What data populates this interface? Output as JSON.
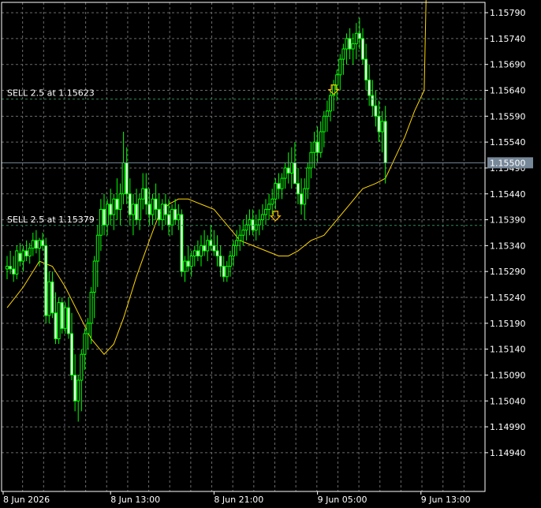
{
  "chart_data": {
    "type": "candlestick",
    "background": "#000000",
    "grid": true,
    "colors": {
      "bull_body": "#000000",
      "bear_body": "#ffffff",
      "bull_wick": "#00ff00",
      "bear_wick": "#00ff00",
      "bull_outline": "#00ff00",
      "bear_outline": "#00ff00",
      "moving_average": "#ffd700",
      "grid": "#6b6b6b",
      "axis_text": "#ffffff",
      "current_price_line": "#778899",
      "trade_level_line": "#2e8b57",
      "sell_arrow": "#ffc000"
    },
    "y_axis": {
      "min": 1.1492,
      "max": 1.158,
      "ticks": [
        "1.15790",
        "1.15740",
        "1.15690",
        "1.15640",
        "1.15590",
        "1.15540",
        "1.15490",
        "1.15440",
        "1.15390",
        "1.15340",
        "1.15290",
        "1.15240",
        "1.15190",
        "1.15140",
        "1.15090",
        "1.15040",
        "1.14990",
        "1.14940"
      ]
    },
    "x_axis": {
      "ticks": [
        {
          "label": "8 Jun 2026",
          "bar": 0
        },
        {
          "label": "8 Jun 13:00",
          "bar": 32
        },
        {
          "label": "8 Jun 21:00",
          "bar": 64
        },
        {
          "label": "9 Jun 05:00",
          "bar": 96
        },
        {
          "label": "9 Jun 13:00",
          "bar": 128
        }
      ]
    },
    "current_price": {
      "value": 1.155,
      "label": "1.15500"
    },
    "trade_levels": [
      {
        "label": "SELL 2.5 at 1.15623",
        "price": 1.15623,
        "arrow_bar": 101
      },
      {
        "label": "SELL 2.5 at 1.15379",
        "price": 1.15379,
        "arrow_bar": 83
      }
    ],
    "moving_average": [
      [
        0,
        1.1522
      ],
      [
        5,
        1.1526
      ],
      [
        10,
        1.1531
      ],
      [
        14,
        1.153
      ],
      [
        18,
        1.1526
      ],
      [
        22,
        1.1521
      ],
      [
        26,
        1.1516
      ],
      [
        30,
        1.1513
      ],
      [
        33,
        1.1515
      ],
      [
        36,
        1.152
      ],
      [
        40,
        1.1528
      ],
      [
        44,
        1.1535
      ],
      [
        47,
        1.154
      ],
      [
        50,
        1.1542
      ],
      [
        53,
        1.1543
      ],
      [
        56,
        1.1543
      ],
      [
        60,
        1.1542
      ],
      [
        64,
        1.1541
      ],
      [
        68,
        1.1538
      ],
      [
        72,
        1.1535
      ],
      [
        76,
        1.1534
      ],
      [
        80,
        1.1533
      ],
      [
        84,
        1.1532
      ],
      [
        87,
        1.1532
      ],
      [
        90,
        1.1533
      ],
      [
        94,
        1.1535
      ],
      [
        98,
        1.1536
      ],
      [
        102,
        1.1539
      ],
      [
        106,
        1.1542
      ],
      [
        110,
        1.1545
      ],
      [
        114,
        1.1546
      ],
      [
        117,
        1.1547
      ],
      [
        120,
        1.1551
      ],
      [
        123,
        1.1555
      ],
      [
        126,
        1.156
      ],
      [
        129,
        1.1564
      ],
      [
        132,
        1.1666
      ],
      [
        135,
        1.1668
      ],
      [
        138,
        1.1668
      ],
      [
        141,
        1.1669
      ],
      [
        144,
        1.1668
      ],
      [
        147,
        1.1665
      ]
    ],
    "candles": [
      [
        1.15295,
        1.1532,
        1.15275,
        1.153
      ],
      [
        1.153,
        1.1533,
        1.15285,
        1.15295
      ],
      [
        1.15295,
        1.1532,
        1.1527,
        1.15285
      ],
      [
        1.15285,
        1.1534,
        1.15275,
        1.1533
      ],
      [
        1.15325,
        1.15345,
        1.153,
        1.1531
      ],
      [
        1.1531,
        1.1534,
        1.1529,
        1.1533
      ],
      [
        1.1533,
        1.1535,
        1.1531,
        1.1532
      ],
      [
        1.1532,
        1.15345,
        1.15305,
        1.15335
      ],
      [
        1.15335,
        1.15365,
        1.1532,
        1.1535
      ],
      [
        1.1535,
        1.1537,
        1.15325,
        1.15335
      ],
      [
        1.15335,
        1.15355,
        1.153,
        1.1535
      ],
      [
        1.1535,
        1.15365,
        1.1533,
        1.1534
      ],
      [
        1.1534,
        1.15355,
        1.1519,
        1.15205
      ],
      [
        1.15205,
        1.1529,
        1.1519,
        1.1527
      ],
      [
        1.1527,
        1.1529,
        1.152,
        1.1521
      ],
      [
        1.1521,
        1.1525,
        1.1515,
        1.1516
      ],
      [
        1.1516,
        1.1524,
        1.1515,
        1.1523
      ],
      [
        1.1523,
        1.1524,
        1.1517,
        1.1518
      ],
      [
        1.1518,
        1.1523,
        1.1517,
        1.1522
      ],
      [
        1.1522,
        1.1524,
        1.1516,
        1.1517
      ],
      [
        1.1517,
        1.1521,
        1.1508,
        1.1509
      ],
      [
        1.1509,
        1.1513,
        1.1502,
        1.1504
      ],
      [
        1.1504,
        1.1509,
        1.15,
        1.1508
      ],
      [
        1.1508,
        1.1514,
        1.1502,
        1.1513
      ],
      [
        1.1513,
        1.1518,
        1.151,
        1.1517
      ],
      [
        1.1517,
        1.152,
        1.1514,
        1.1519
      ],
      [
        1.1519,
        1.1526,
        1.1515,
        1.1525
      ],
      [
        1.1525,
        1.1532,
        1.152,
        1.1531
      ],
      [
        1.1531,
        1.1538,
        1.1526,
        1.1536
      ],
      [
        1.1536,
        1.1543,
        1.1533,
        1.1541
      ],
      [
        1.1541,
        1.1544,
        1.1536,
        1.1538
      ],
      [
        1.1538,
        1.1543,
        1.1536,
        1.1542
      ],
      [
        1.1542,
        1.1545,
        1.1538,
        1.154
      ],
      [
        1.154,
        1.1544,
        1.1537,
        1.1543
      ],
      [
        1.1543,
        1.1547,
        1.1539,
        1.1541
      ],
      [
        1.1541,
        1.1546,
        1.1538,
        1.1544
      ],
      [
        1.1544,
        1.1556,
        1.1542,
        1.155
      ],
      [
        1.155,
        1.1553,
        1.1542,
        1.1544
      ],
      [
        1.1544,
        1.1547,
        1.1538,
        1.154
      ],
      [
        1.154,
        1.1544,
        1.1536,
        1.1542
      ],
      [
        1.1542,
        1.1545,
        1.1538,
        1.1539
      ],
      [
        1.1539,
        1.1544,
        1.1537,
        1.1543
      ],
      [
        1.1543,
        1.1548,
        1.1541,
        1.1545
      ],
      [
        1.1545,
        1.1548,
        1.154,
        1.1542
      ],
      [
        1.1542,
        1.1545,
        1.1538,
        1.154
      ],
      [
        1.154,
        1.1544,
        1.1538,
        1.1543
      ],
      [
        1.1543,
        1.1546,
        1.1539,
        1.1541
      ],
      [
        1.1541,
        1.1544,
        1.1538,
        1.1539
      ],
      [
        1.1539,
        1.1543,
        1.1537,
        1.1542
      ],
      [
        1.1542,
        1.1544,
        1.1538,
        1.154
      ],
      [
        1.154,
        1.1543,
        1.1536,
        1.1538
      ],
      [
        1.1538,
        1.1542,
        1.1536,
        1.1541
      ],
      [
        1.1541,
        1.1543,
        1.1538,
        1.1539
      ],
      [
        1.1539,
        1.1542,
        1.1537,
        1.154
      ],
      [
        1.154,
        1.1541,
        1.1528,
        1.1529
      ],
      [
        1.1529,
        1.1532,
        1.1527,
        1.1531
      ],
      [
        1.1531,
        1.1534,
        1.1529,
        1.153
      ],
      [
        1.153,
        1.1533,
        1.1528,
        1.1532
      ],
      [
        1.1532,
        1.1534,
        1.153,
        1.1533
      ],
      [
        1.1533,
        1.1535,
        1.1531,
        1.1532
      ],
      [
        1.1532,
        1.1536,
        1.153,
        1.1534
      ],
      [
        1.1534,
        1.1537,
        1.1532,
        1.1533
      ],
      [
        1.1533,
        1.1536,
        1.1531,
        1.1535
      ],
      [
        1.1535,
        1.1538,
        1.1533,
        1.1534
      ],
      [
        1.1534,
        1.1537,
        1.1532,
        1.1533
      ],
      [
        1.1533,
        1.1536,
        1.153,
        1.1532
      ],
      [
        1.1532,
        1.1534,
        1.1528,
        1.153
      ],
      [
        1.153,
        1.1532,
        1.1527,
        1.1528
      ],
      [
        1.1528,
        1.1531,
        1.1527,
        1.153
      ],
      [
        1.153,
        1.1533,
        1.1528,
        1.1532
      ],
      [
        1.1532,
        1.1535,
        1.153,
        1.1534
      ],
      [
        1.1534,
        1.1537,
        1.1532,
        1.1535
      ],
      [
        1.1535,
        1.1538,
        1.1533,
        1.1536
      ],
      [
        1.1536,
        1.1539,
        1.1534,
        1.1537
      ],
      [
        1.1537,
        1.154,
        1.1535,
        1.1538
      ],
      [
        1.1538,
        1.1541,
        1.1536,
        1.1539
      ],
      [
        1.1539,
        1.1541,
        1.1536,
        1.1537
      ],
      [
        1.1537,
        1.154,
        1.1535,
        1.1538
      ],
      [
        1.1538,
        1.1541,
        1.1536,
        1.1539
      ],
      [
        1.1539,
        1.1542,
        1.1537,
        1.154
      ],
      [
        1.154,
        1.1543,
        1.1538,
        1.1541
      ],
      [
        1.1541,
        1.1544,
        1.1539,
        1.1542
      ],
      [
        1.1542,
        1.1545,
        1.154,
        1.1543
      ],
      [
        1.1543,
        1.1547,
        1.1541,
        1.1546
      ],
      [
        1.1546,
        1.1548,
        1.1543,
        1.1545
      ],
      [
        1.1545,
        1.1548,
        1.1543,
        1.1547
      ],
      [
        1.1547,
        1.155,
        1.1545,
        1.1549
      ],
      [
        1.1549,
        1.1552,
        1.1546,
        1.1548
      ],
      [
        1.1548,
        1.1553,
        1.1545,
        1.155
      ],
      [
        1.155,
        1.1554,
        1.1548,
        1.1546
      ],
      [
        1.1546,
        1.1549,
        1.1542,
        1.1544
      ],
      [
        1.1544,
        1.1547,
        1.154,
        1.1542
      ],
      [
        1.1542,
        1.1547,
        1.1539,
        1.1545
      ],
      [
        1.1545,
        1.155,
        1.1543,
        1.1549
      ],
      [
        1.1549,
        1.1554,
        1.1547,
        1.1552
      ],
      [
        1.1552,
        1.1556,
        1.1549,
        1.1554
      ],
      [
        1.1554,
        1.1557,
        1.155,
        1.1552
      ],
      [
        1.1552,
        1.1558,
        1.1551,
        1.1556
      ],
      [
        1.1556,
        1.156,
        1.1553,
        1.1559
      ],
      [
        1.1559,
        1.1562,
        1.1556,
        1.156
      ],
      [
        1.156,
        1.1564,
        1.1558,
        1.1563
      ],
      [
        1.1563,
        1.1566,
        1.156,
        1.1565
      ],
      [
        1.1565,
        1.1568,
        1.1562,
        1.1567
      ],
      [
        1.1567,
        1.1571,
        1.1564,
        1.157
      ],
      [
        1.157,
        1.1573,
        1.1567,
        1.1572
      ],
      [
        1.1572,
        1.1575,
        1.1569,
        1.1574
      ],
      [
        1.1574,
        1.1576,
        1.157,
        1.1572
      ],
      [
        1.1572,
        1.1575,
        1.1569,
        1.1573
      ],
      [
        1.1573,
        1.1577,
        1.157,
        1.1575
      ],
      [
        1.1575,
        1.1578,
        1.1572,
        1.1574
      ],
      [
        1.1574,
        1.1576,
        1.1569,
        1.157
      ],
      [
        1.157,
        1.1573,
        1.1564,
        1.1566
      ],
      [
        1.1566,
        1.1569,
        1.1561,
        1.1563
      ],
      [
        1.1563,
        1.1566,
        1.1559,
        1.1561
      ],
      [
        1.1561,
        1.1564,
        1.1557,
        1.1559
      ],
      [
        1.1559,
        1.1562,
        1.1554,
        1.1556
      ],
      [
        1.1556,
        1.156,
        1.1552,
        1.1558
      ],
      [
        1.1558,
        1.1561,
        1.1546,
        1.155
      ]
    ]
  }
}
